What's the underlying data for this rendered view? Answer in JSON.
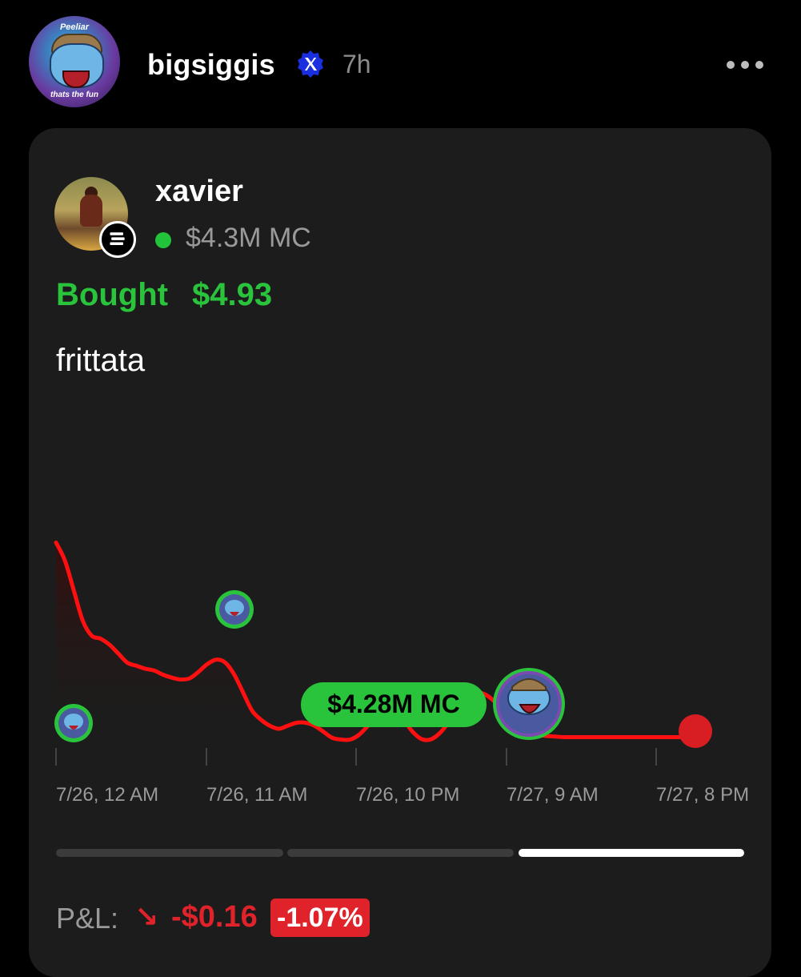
{
  "post": {
    "username": "bigsiggis",
    "time_ago": "7h",
    "avatar_caption_top": "Peeliar",
    "avatar_caption_bottom": "thats the fun"
  },
  "card": {
    "token_name": "xavier",
    "market_cap": "$4.3M MC",
    "bought_label": "Bought",
    "bought_amount": "$4.93",
    "comment": "frittata",
    "hover_pill": "$4.28M MC",
    "pnl_label": "P&L:",
    "pnl_arrow": "↘",
    "pnl_amount": "-$0.16",
    "pnl_percent": "-1.07%"
  },
  "range_tabs": [
    {
      "active": false
    },
    {
      "active": false
    },
    {
      "active": true
    }
  ],
  "colors": {
    "accent_green": "#2ac33c",
    "loss_red": "#e0232b",
    "line_red": "#ff1010"
  },
  "icons": {
    "verified": "x-verified-badge-icon",
    "more": "more-horizontal-icon",
    "chain": "solana-icon"
  },
  "chart_data": {
    "type": "line",
    "x_ticks": [
      "7/26, 12 AM",
      "7/26, 11 AM",
      "7/26, 10 PM",
      "7/27, 9 AM",
      "7/27, 8 PM"
    ],
    "series": [
      {
        "x": [
          0,
          0.5,
          1,
          1.5,
          2,
          2.5,
          3,
          3.5,
          4,
          4.5,
          5,
          5.5,
          6,
          6.5,
          7,
          7.5,
          8,
          8.5,
          9,
          9.5,
          10,
          10.5,
          11,
          11.5,
          12,
          12.5,
          13,
          13.5,
          14,
          14.5,
          15,
          15.5,
          16,
          16.5,
          17,
          17.5,
          18,
          18.5,
          19,
          19.5,
          20,
          20.5,
          21,
          21.5,
          22,
          22.5,
          23,
          23.5,
          24,
          24.5,
          25,
          25.5,
          26,
          26.5,
          27,
          27.5,
          28,
          28.5,
          29,
          29.5,
          30,
          30.5,
          31,
          31.5,
          32,
          32.5,
          33,
          33.5,
          34,
          34.5,
          35,
          35.5,
          36,
          36.5,
          37,
          37.5,
          38,
          38.5,
          39,
          39.5,
          40,
          40.5,
          41,
          41.5,
          42,
          42.5,
          43,
          43.5,
          44
        ],
        "values": [
          4.55,
          4.52,
          4.47,
          4.42,
          4.395,
          4.39,
          4.38,
          4.365,
          4.35,
          4.345,
          4.34,
          4.337,
          4.33,
          4.325,
          4.322,
          4.324,
          4.335,
          4.348,
          4.355,
          4.35,
          4.33,
          4.3,
          4.27,
          4.255,
          4.245,
          4.24,
          4.245,
          4.25,
          4.25,
          4.245,
          4.235,
          4.225,
          4.222,
          4.222,
          4.23,
          4.245,
          4.26,
          4.27,
          4.27,
          4.255,
          4.235,
          4.223,
          4.222,
          4.232,
          4.25,
          4.275,
          4.294,
          4.3,
          4.298,
          4.288,
          4.272,
          4.258,
          4.245,
          4.235,
          4.23,
          4.228,
          4.227,
          4.226,
          4.226,
          4.226,
          4.226,
          4.226,
          4.226,
          4.226,
          4.226,
          4.226,
          4.226,
          4.226,
          4.226,
          4.226,
          4.226,
          4.226,
          4.226,
          4.226,
          4.226,
          4.226,
          4.226,
          4.226,
          4.226,
          4.226,
          4.226,
          4.226,
          4.226,
          4.226,
          4.226,
          4.226,
          4.226,
          4.226,
          4.226
        ]
      }
    ],
    "trade_markers": [
      {
        "x": 0.8,
        "value": 4.235
      },
      {
        "x": 9.0,
        "value": 4.39
      },
      {
        "x": 24.5,
        "value": 4.255
      }
    ],
    "ylim": [
      4.2,
      4.6
    ],
    "xlim": [
      0,
      36
    ],
    "grid": false
  }
}
